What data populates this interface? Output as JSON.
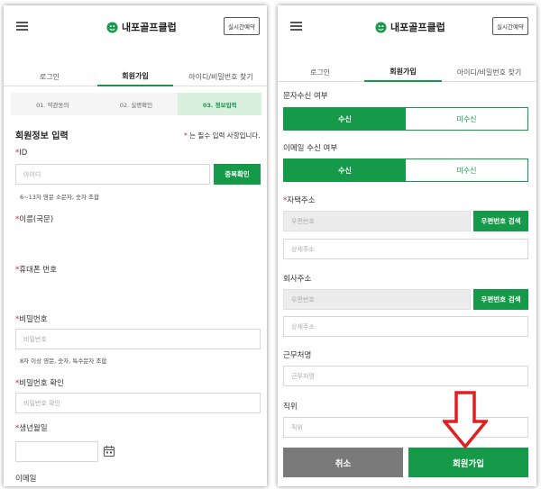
{
  "header": {
    "brand": "내포골프클럽",
    "reserve_button": "실시간예약"
  },
  "tabs": {
    "login": "로그인",
    "signup": "회원가입",
    "find": "아이디/비밀번호 찾기"
  },
  "steps": [
    "01. 약관동의",
    "02. 실명확인",
    "03. 정보입력"
  ],
  "left": {
    "section_title": "회원정보 입력",
    "required_note": "는 필수 입력 사항입니다.",
    "id_label": "ID",
    "id_placeholder": "아이디",
    "dup_check": "중복확인",
    "id_hint": "6~13자 영문 소문자, 숫자 조합",
    "name_label": "이름(국문)",
    "phone_label": "휴대폰 번호",
    "pw_label": "비밀번호",
    "pw_placeholder": "비밀번호",
    "pw_hint": "8자 이상 영문, 숫자, 특수문자 조합",
    "pw_confirm_label": "비밀번호 확인",
    "pw_confirm_placeholder": "비밀번호 확인",
    "birth_label": "생년월일",
    "email_label": "이메일"
  },
  "right": {
    "sms_label": "문자수신 여부",
    "email_recv_label": "이메일 수신 여부",
    "receive": "수신",
    "not_receive": "미수신",
    "home_addr_label": "자택주소",
    "zip_placeholder": "우편번호",
    "zip_search": "우편번호 검색",
    "detail_placeholder": "상세주소",
    "company_addr_label": "회사주소",
    "workplace_label": "근무처명",
    "workplace_placeholder": "근무처명",
    "position_label": "직위",
    "position_placeholder": "직위",
    "cancel": "취소",
    "signup": "회원가입"
  },
  "colors": {
    "accent": "#159a49",
    "cancel_gray": "#7a7a7a",
    "required_red": "#d22222",
    "arrow_red": "#e02020"
  }
}
